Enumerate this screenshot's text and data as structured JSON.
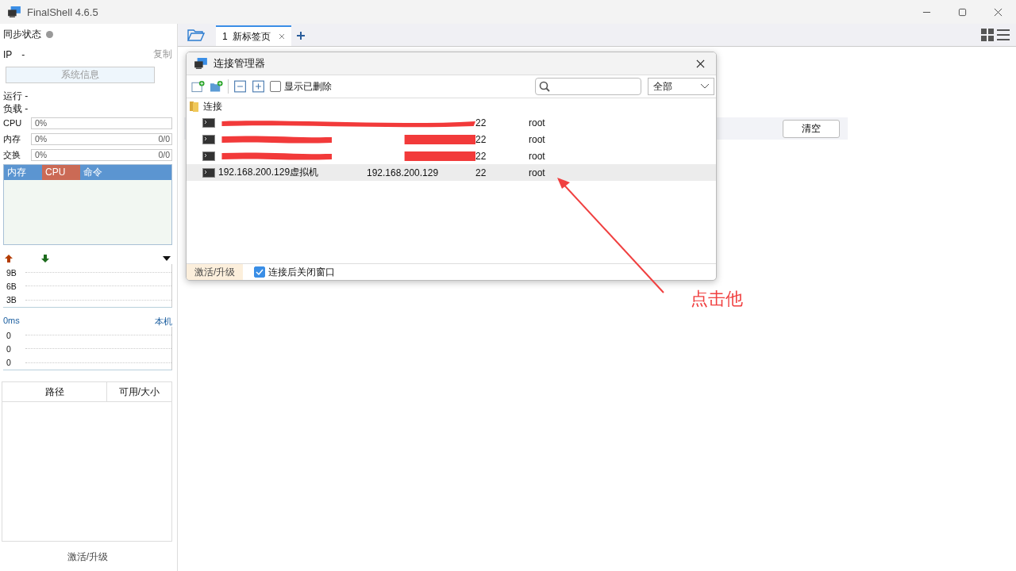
{
  "window": {
    "title": "FinalShell 4.6.5"
  },
  "sidebar": {
    "sync_label": "同步状态",
    "ip_label": "IP",
    "ip_value": "-",
    "copy": "复制",
    "sysinfo_button": "系统信息",
    "uptime": "运行 -",
    "load": "负载 -",
    "meters": [
      {
        "label": "CPU",
        "reading": "0%"
      },
      {
        "label": "内存",
        "reading": "0%",
        "total": "0/0"
      },
      {
        "label": "交换",
        "reading": "0%",
        "total": "0/0"
      }
    ],
    "process_tabs": [
      {
        "label": "内存",
        "selected": false
      },
      {
        "label": "CPU",
        "selected": true
      },
      {
        "label": "命令",
        "selected": false
      }
    ],
    "net_ticks": [
      "9B",
      "6B",
      "3B"
    ],
    "ping": {
      "reading": "0ms",
      "target": "本机",
      "ticks": [
        "0",
        "0",
        "0"
      ]
    },
    "disk_columns": [
      "路径",
      "可用/大小"
    ],
    "activate": "激活/升级"
  },
  "tabs": [
    {
      "number": "1",
      "label": "新标签页",
      "selected": true
    }
  ],
  "clear_button": "清空",
  "dialog": {
    "title": "连接管理器",
    "show_deleted": {
      "label": "显示已删除",
      "checked": false
    },
    "filter": "全部",
    "folder": "连接",
    "connections": [
      {
        "kind": "redacted",
        "port": "22",
        "user": "root",
        "selected": false
      },
      {
        "kind": "redacted",
        "port": "22",
        "user": "root",
        "selected": false
      },
      {
        "kind": "redacted",
        "port": "22",
        "user": "root",
        "selected": false
      },
      {
        "kind": "plain",
        "name": "192.168.200.129虚拟机",
        "host": "192.168.200.129",
        "port": "22",
        "user": "root",
        "selected": true
      }
    ],
    "activate": "激活/升级",
    "close_after_connect": {
      "label": "连接后关闭窗口",
      "checked": true
    }
  },
  "annotation": {
    "text": "点击他"
  }
}
